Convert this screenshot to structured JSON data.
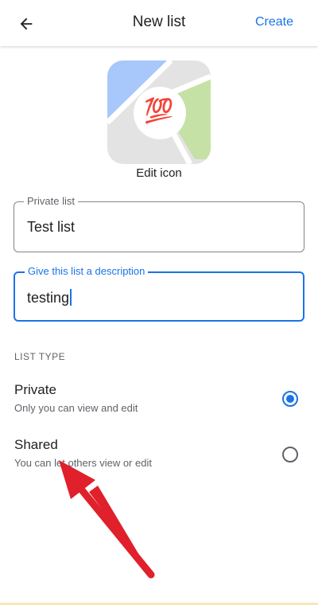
{
  "appbar": {
    "title": "New list",
    "create_label": "Create",
    "back_icon": "arrow-back-icon"
  },
  "list_icon": {
    "emoji": "💯",
    "edit_label": "Edit icon",
    "map_colors": {
      "water": "#a8c7fa",
      "park": "#c5e1a5",
      "road": "#e3e3e3",
      "center": "#ffffff"
    }
  },
  "fields": {
    "name": {
      "label": "Private list",
      "value": "Test list"
    },
    "description": {
      "label": "Give this list a description",
      "value": "testing"
    }
  },
  "list_type": {
    "heading": "LIST TYPE",
    "options": [
      {
        "title": "Private",
        "subtitle": "Only you can view and edit",
        "selected": true
      },
      {
        "title": "Shared",
        "subtitle": "You can let others view or edit",
        "selected": false
      }
    ]
  },
  "colors": {
    "accent": "#1a73e8",
    "annotation_arrow": "#e0202a"
  }
}
